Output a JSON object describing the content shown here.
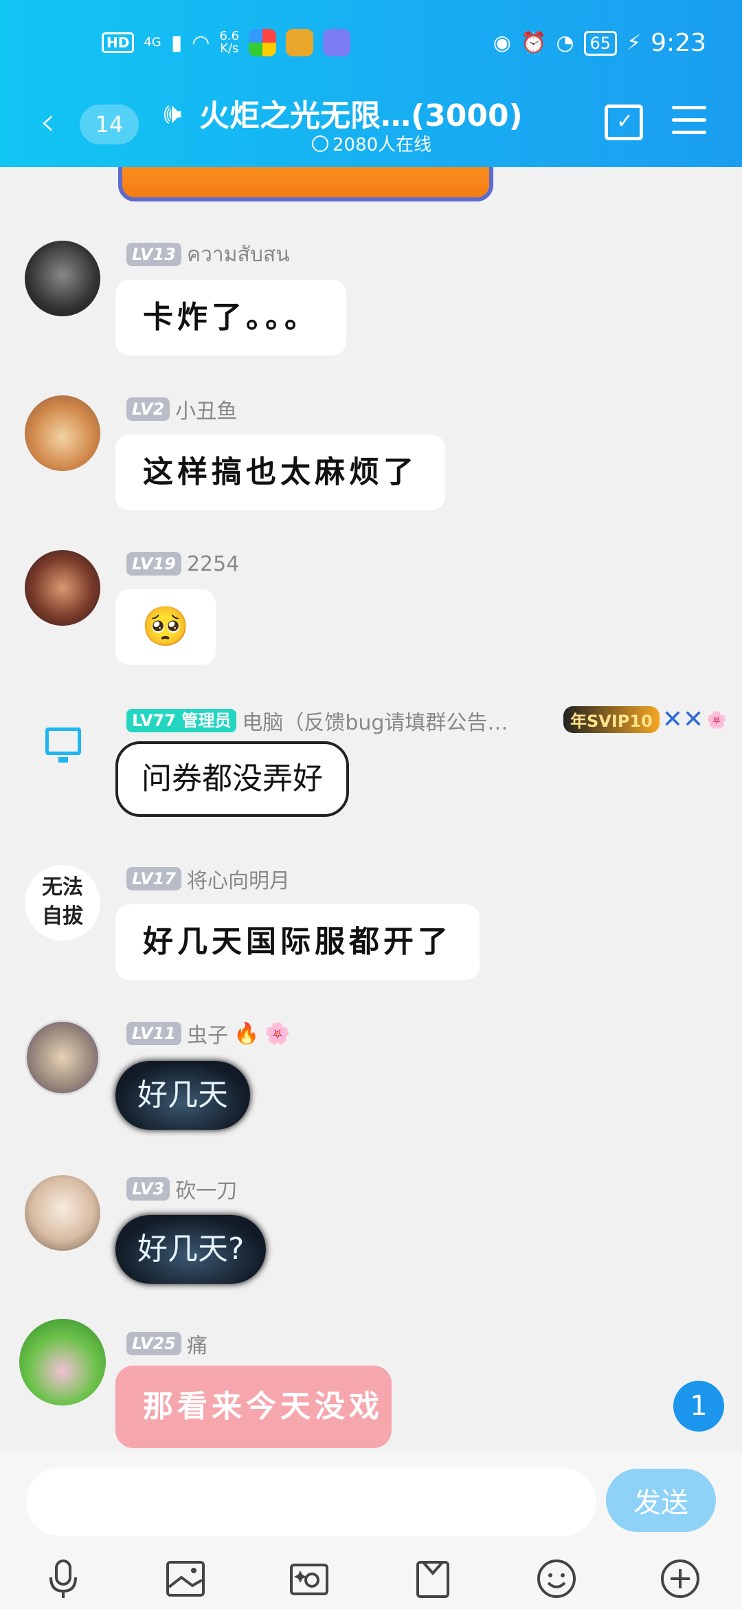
{
  "status": {
    "network": "4G",
    "speed_value": "6.6",
    "speed_unit": "K/s",
    "battery": "65",
    "time": "9:23"
  },
  "header": {
    "unread_count": "14",
    "title": "火炬之光无限…(3000)",
    "online": "2080人在线"
  },
  "messages": [
    {
      "level": "LV13",
      "name": "ความสับสน",
      "text": "卡炸了。。。"
    },
    {
      "level": "LV2",
      "name": "小丑鱼",
      "text": "这样搞也太麻烦了"
    },
    {
      "level": "LV19",
      "name": "2254",
      "text": "🥺"
    },
    {
      "level": "LV77",
      "role": "管理员",
      "name": "电脑（反馈bug请填群公告…",
      "text": "问券都没弄好",
      "vip": "SVIP10",
      "vip_prefix": "年"
    },
    {
      "level": "LV17",
      "name": "将心向明月",
      "text": "好几天国际服都开了",
      "avatar_text": "无法自拔"
    },
    {
      "level": "LV11",
      "name": "虫子",
      "text": "好几天"
    },
    {
      "level": "LV3",
      "name": "砍一刀",
      "text": "好几天?"
    },
    {
      "level": "LV25",
      "name": "痛",
      "text": "那看来今天没戏"
    }
  ],
  "new_messages_badge": "1",
  "input": {
    "placeholder": "",
    "send_label": "发送"
  },
  "toolbar": [
    "mic-icon",
    "image-icon",
    "camera-icon",
    "file-icon",
    "emoji-icon",
    "plus-icon"
  ]
}
